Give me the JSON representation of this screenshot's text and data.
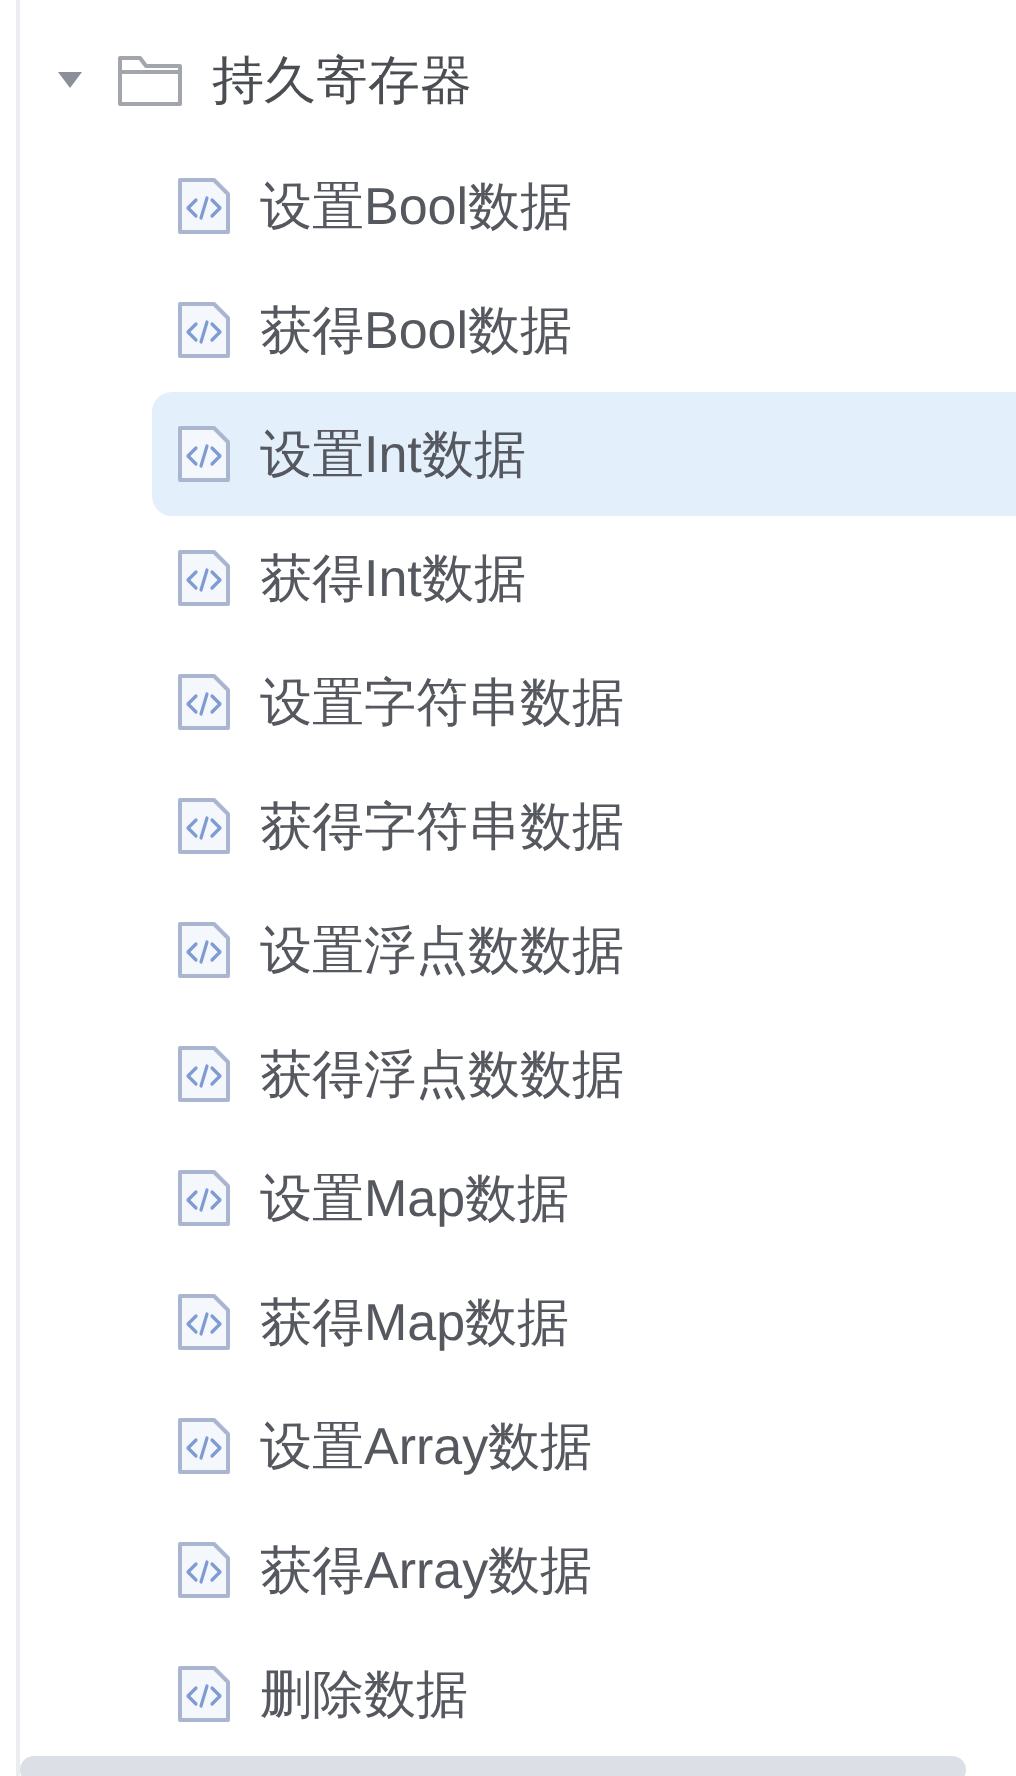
{
  "tree": {
    "label": "持久寄存器",
    "expanded": true,
    "children": [
      {
        "label": "设置Bool数据",
        "selected": false
      },
      {
        "label": "获得Bool数据",
        "selected": false
      },
      {
        "label": "设置Int数据",
        "selected": true
      },
      {
        "label": "获得Int数据",
        "selected": false
      },
      {
        "label": "设置字符串数据",
        "selected": false
      },
      {
        "label": "获得字符串数据",
        "selected": false
      },
      {
        "label": "设置浮点数数据",
        "selected": false
      },
      {
        "label": "获得浮点数数据",
        "selected": false
      },
      {
        "label": "设置Map数据",
        "selected": false
      },
      {
        "label": "获得Map数据",
        "selected": false
      },
      {
        "label": "设置Array数据",
        "selected": false
      },
      {
        "label": "获得Array数据",
        "selected": false
      },
      {
        "label": "删除数据",
        "selected": false
      }
    ]
  }
}
